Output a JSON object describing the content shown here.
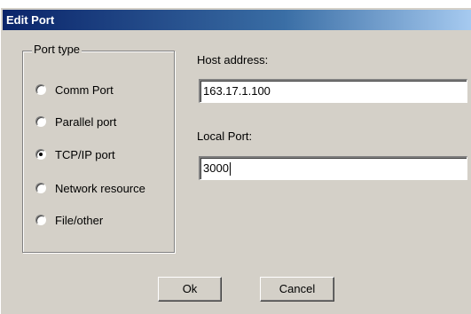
{
  "window": {
    "title": "Edit Port"
  },
  "port_type": {
    "legend": "Port type",
    "options": [
      {
        "label": "Comm Port",
        "checked": false
      },
      {
        "label": "Parallel port",
        "checked": false
      },
      {
        "label": "TCP/IP port",
        "checked": true
      },
      {
        "label": "Network resource",
        "checked": false
      },
      {
        "label": "File/other",
        "checked": false
      }
    ]
  },
  "host": {
    "label": "Host address:",
    "value": "163.17.1.100"
  },
  "local_port": {
    "label": "Local Port:",
    "value": "3000"
  },
  "buttons": {
    "ok_label": "Ok",
    "cancel_label": "Cancel"
  }
}
